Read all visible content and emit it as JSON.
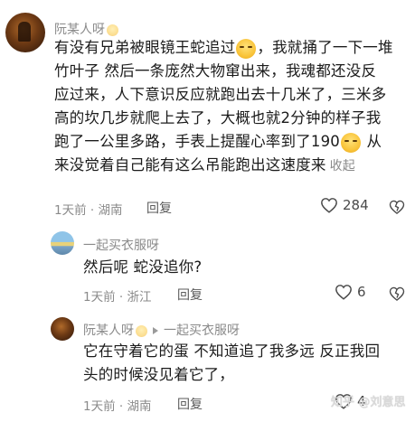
{
  "comment": {
    "username": "阮某人呀",
    "lines": [
      "有没有兄弟被眼镜王蛇追过",
      "，我就捅了一下一堆",
      "竹叶子 然后一条庞然大物窜出来，我魂都还没反",
      "应过来，人下意识反应就跑出去十几米了，三米多",
      "高的坎几步就爬上去了，大概也就2分钟的样子我",
      "跑了一公里多路，手表上提醒心率到了190",
      " 从",
      "来没觉着自己能有这么吊能跑出这速度来"
    ],
    "collapse_label": "收起",
    "time": "1天前",
    "location": "湖南",
    "reply_label": "回复",
    "likes": "284"
  },
  "replies": [
    {
      "username": "一起买衣服呀",
      "text": "然后呢 蛇没追你?",
      "time": "1天前",
      "location": "浙江",
      "reply_label": "回复",
      "likes": "6"
    },
    {
      "username": "阮某人呀",
      "reply_to": "一起买衣服呀",
      "lines": [
        "它在守着它的蛋  不知道追了我多远  反正我回",
        "头的时候没见着它了，"
      ],
      "time": "1天前",
      "location": "湖南",
      "reply_label": "回复",
      "likes": "4"
    }
  ],
  "watermark": "知乎 @刘意思",
  "colors": {
    "meta": "#8a8a8a",
    "text": "#1b1b1b",
    "background": "#ffffff"
  },
  "icons": [
    "emoji-smile-icon",
    "heart-icon",
    "dislike-heart-icon",
    "reply-arrow-icon"
  ]
}
